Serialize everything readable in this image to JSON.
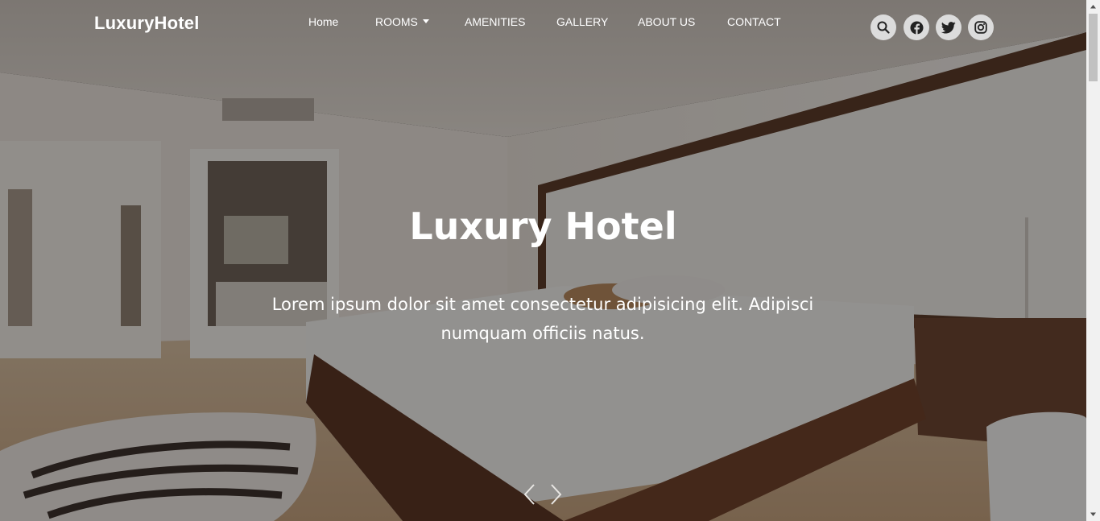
{
  "navbar": {
    "brand": "LuxuryHotel",
    "links": [
      {
        "label": "Home"
      },
      {
        "label": "ROOMS"
      },
      {
        "label": "AMENITIES"
      },
      {
        "label": "GALLERY"
      },
      {
        "label": "ABOUT US"
      },
      {
        "label": "CONTACT"
      }
    ],
    "icons": [
      "search-icon",
      "facebook-icon",
      "twitter-icon",
      "instagram-icon"
    ]
  },
  "hero": {
    "title": "Luxury Hotel",
    "text": "Lorem ipsum dolor sit amet consectetur adipisicing elit. Adipisci numquam officiis natus.",
    "background": "hotel-bedroom-photo"
  },
  "colors": {
    "text": "#ffffff",
    "icon_bg": "#dcdcdc",
    "icon_fg": "#222222",
    "overlay": "rgba(10,8,6,0.42)"
  }
}
